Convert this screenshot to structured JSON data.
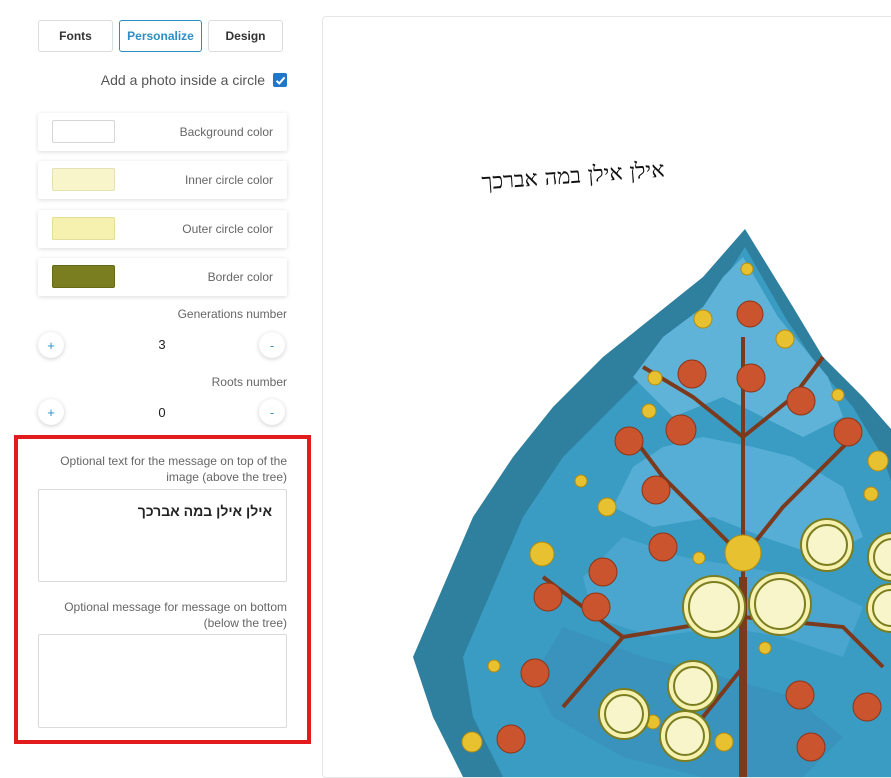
{
  "tabs": [
    {
      "label": "Fonts",
      "active": false
    },
    {
      "label": "Personalize",
      "active": true
    },
    {
      "label": "Design",
      "active": false
    }
  ],
  "photo_option": {
    "label": "Add a photo inside a circle",
    "checked": true
  },
  "colors": [
    {
      "label": "Background color",
      "value": "#ffffff"
    },
    {
      "label": "Inner circle color",
      "value": "#f7f5c9"
    },
    {
      "label": "Outer circle color",
      "value": "#f6f1ae"
    },
    {
      "label": "Border color",
      "value": "#7a7d20"
    }
  ],
  "generations": {
    "label": "Generations number",
    "value": "3",
    "plus": "+",
    "minus": "-"
  },
  "roots": {
    "label": "Roots number",
    "value": "0",
    "plus": "+",
    "minus": "-"
  },
  "top_message": {
    "label": "Optional text for the message on top of the image (above the tree)",
    "value": "אילן אילן במה אברכך"
  },
  "bottom_message": {
    "label": "Optional message for message on bottom (below the tree)",
    "value": ""
  },
  "preview": {
    "title": "אילן אילן במה אברכך"
  }
}
